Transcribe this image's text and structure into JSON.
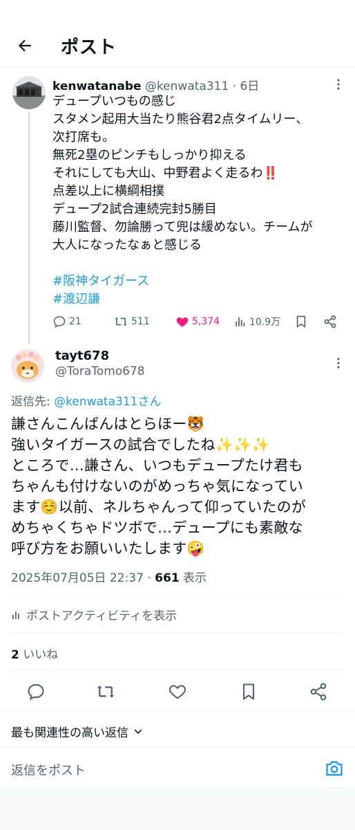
{
  "header": {
    "title": "ポスト"
  },
  "parent_post": {
    "name": "kenwatanabe",
    "handle": "@kenwata311",
    "dot": "·",
    "time": "6日",
    "lines": [
      "デュープいつもの感じ",
      "スタメン起用大当たり熊谷君2点タイムリー、",
      "次打席も。",
      "無死2塁のピンチもしっかり抑える",
      "それにしても大山、中野君よく走るわ",
      "点差以上に横綱相撲",
      "デュープ2試合連続完封5勝目",
      "藤川監督、勿論勝って兜は緩めない。チームが",
      "大人になったなぁと感じる"
    ],
    "emphasis": "‼️",
    "hashtags": [
      "#阪神タイガース",
      "#渡辺謙"
    ],
    "stats": {
      "replies": "21",
      "reposts": "511",
      "likes": "5,374",
      "views": "10.9万"
    }
  },
  "reply_post": {
    "name": "tayt678",
    "handle": "@ToraTomo678",
    "reply_to_label": "返信先: ",
    "reply_to_mention": "@kenwata311さん",
    "lines": [
      "謙さんこんばんはとらほー🐯",
      "強いタイガースの試合でしたね✨✨✨",
      "ところで…謙さん、いつもデュープたけ君も",
      "ちゃんも付けないのがめっちゃ気になってい",
      "ます☺️以前、ネルちゃんって仰っていたのが",
      "めちゃくちゃドツボで…デュープにも素敵な",
      "呼び方をお願いいたします🤪"
    ],
    "datetime": "2025年07月05日 22:37",
    "dot": " · ",
    "views": "661",
    "views_label": " 表示",
    "activity_label": "ポストアクティビティを表示",
    "likes_count": "2",
    "likes_label": " いいね"
  },
  "sort_label": "最も関連性の高い返信",
  "compose": {
    "placeholder": "返信をポスト"
  },
  "colors": {
    "accent": "#1d9bf0",
    "like": "#f91880",
    "muted": "#536471",
    "text": "#0f1419"
  },
  "icons": [
    "back-arrow-icon",
    "more-icon",
    "reply-icon",
    "repost-icon",
    "heart-icon",
    "views-icon",
    "bookmark-icon",
    "share-icon",
    "chevron-down-icon",
    "camera-icon"
  ]
}
